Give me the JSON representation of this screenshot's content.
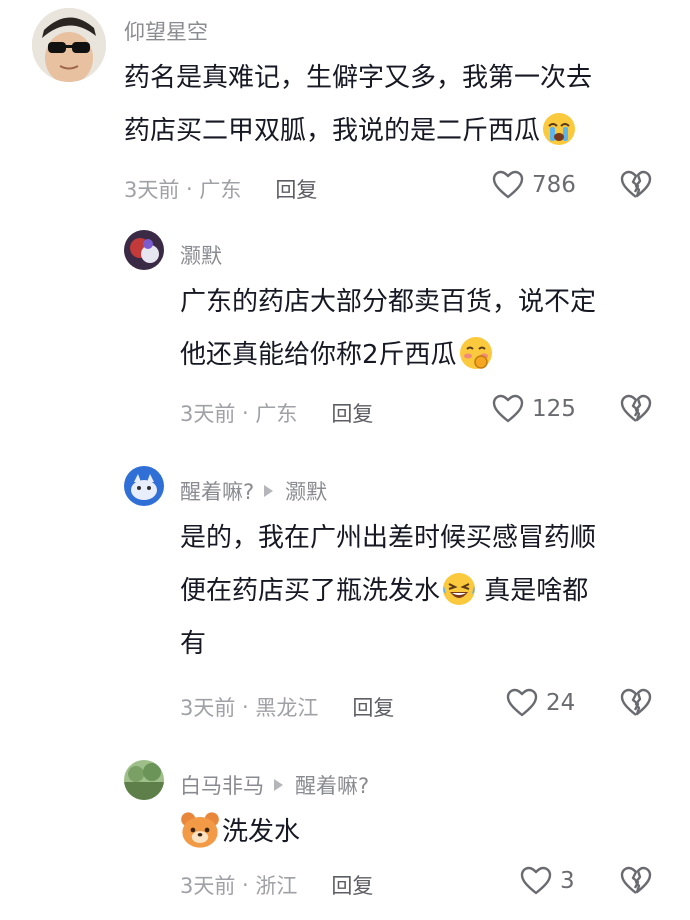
{
  "comments": [
    {
      "username": "仰望星空",
      "reply_to": "",
      "lines": [
        "药名是真难记，生僻字又多，我第一次去",
        "药店买二甲双胍，我说的是二斤西瓜"
      ],
      "emoji": "crying-emoji",
      "time": "3天前",
      "location": "广东",
      "reply_label": "回复",
      "likes": "786"
    },
    {
      "username": "灏默",
      "reply_to": "",
      "lines": [
        "广东的药店大部分都卖百货，说不定",
        "他还真能给你称2斤西瓜"
      ],
      "emoji": "blush-emoji",
      "time": "3天前",
      "location": "广东",
      "reply_label": "回复",
      "likes": "125"
    },
    {
      "username": "醒着嘛?",
      "reply_to": "灏默",
      "lines": [
        "是的，我在广州出差时候买感冒药顺",
        "便在药店买了瓶洗发水",
        "有"
      ],
      "line2_suffix": " 真是啥都",
      "emoji": "laugh-cry-emoji",
      "time": "3天前",
      "location": "黑龙江",
      "reply_label": "回复",
      "likes": "24"
    },
    {
      "username": "白马非马",
      "reply_to": "醒着嘛?",
      "lines": [
        "洗发水"
      ],
      "emoji": "bear-emoji",
      "time": "3天前",
      "location": "浙江",
      "reply_label": "回复",
      "likes": "3"
    }
  ],
  "colors": {
    "text": "#161823",
    "muted": "#8a8b91",
    "heart": "#6a6b70"
  }
}
